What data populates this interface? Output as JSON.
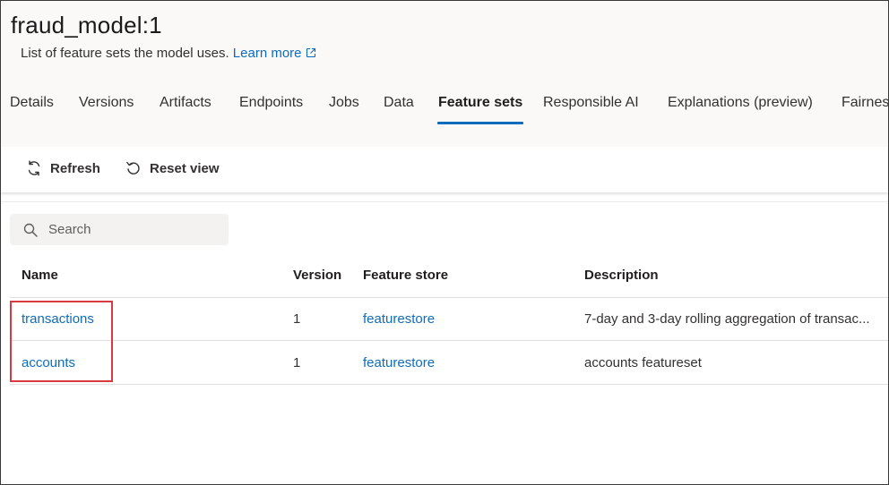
{
  "page": {
    "title": "fraud_model:1",
    "subtitle": "List of feature sets the model uses.",
    "learn_more": "Learn more"
  },
  "tabs": [
    {
      "label": "Details"
    },
    {
      "label": "Versions"
    },
    {
      "label": "Artifacts"
    },
    {
      "label": "Endpoints"
    },
    {
      "label": "Jobs"
    },
    {
      "label": "Data"
    },
    {
      "label": "Feature sets",
      "active": true
    },
    {
      "label": "Responsible AI"
    },
    {
      "label": "Explanations (preview)"
    },
    {
      "label": "Fairness"
    }
  ],
  "toolbar": {
    "refresh_label": "Refresh",
    "reset_view_label": "Reset view"
  },
  "search": {
    "placeholder": "Search"
  },
  "table": {
    "columns": [
      "Name",
      "Version",
      "Feature store",
      "Description"
    ],
    "rows": [
      {
        "name": "transactions",
        "version": "1",
        "feature_store": "featurestore",
        "description": "7-day and 3-day rolling aggregation of transac..."
      },
      {
        "name": "accounts",
        "version": "1",
        "feature_store": "featurestore",
        "description": "accounts featureset"
      }
    ]
  },
  "colors": {
    "accent": "#0f6cbd",
    "highlight_box": "#d93a3f",
    "header_bg": "#faf9f8"
  }
}
